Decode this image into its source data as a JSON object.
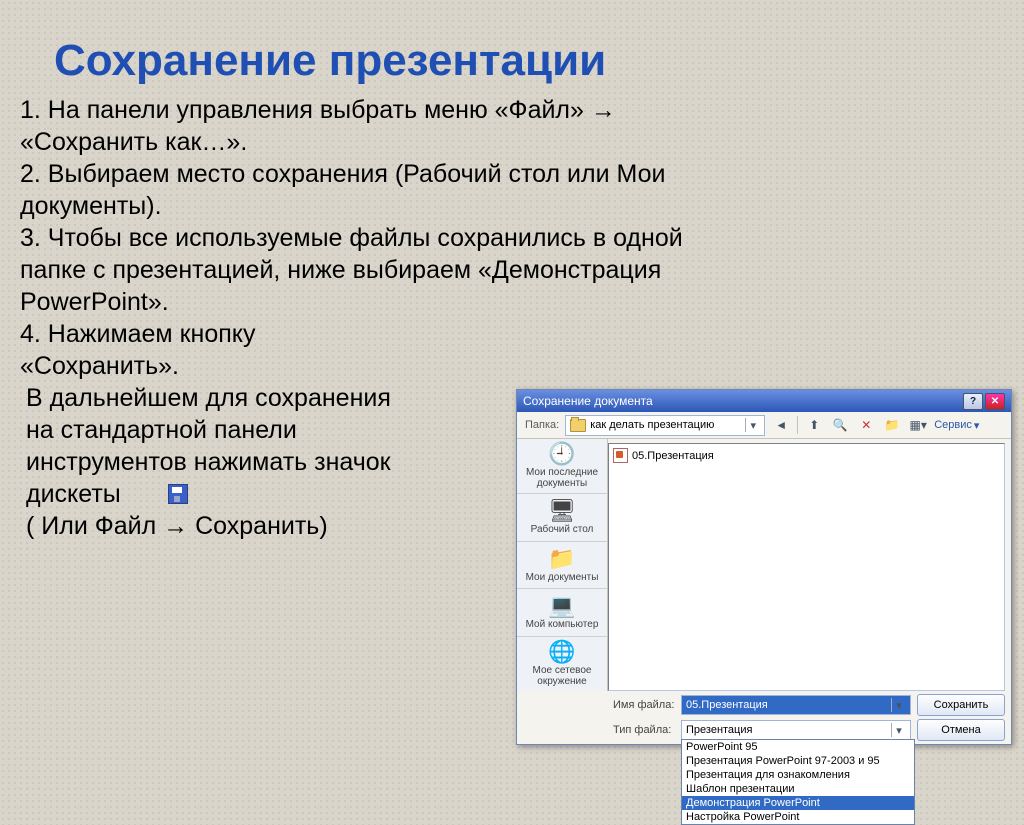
{
  "title": "Сохранение презентации",
  "steps": {
    "l1": "1. На панели управления выбрать меню «Файл» →",
    "l2": "«Сохранить как…».",
    "l3": "2. Выбираем место сохранения (Рабочий стол или Мои",
    "l4": "документы).",
    "l5": "3. Чтобы все используемые файлы сохранились в одной",
    "l6": "папке с презентацией, ниже выбираем «Демонстрация",
    "l7": "PowerPoint».",
    "l8": "4. Нажимаем кнопку",
    "l9": "«Сохранить».",
    "l10": "В дальнейшем для сохранения",
    "l11": "на стандартной панели",
    "l12": "инструментов нажимать значок",
    "l13": "дискеты",
    "l14": "( Или Файл → Сохранить)"
  },
  "dialog": {
    "title": "Сохранение документа",
    "folder_label": "Папка:",
    "folder_value": "как делать презентацию",
    "service_label": "Сервис",
    "places": [
      {
        "icon": "🕘",
        "label": "Мои последние документы"
      },
      {
        "icon": "🖥",
        "label": "Рабочий стол"
      },
      {
        "icon": "📁",
        "label": "Мои документы"
      },
      {
        "icon": "💻",
        "label": "Мой компьютер"
      },
      {
        "icon": "🌐",
        "label": "Мое сетевое окружение"
      }
    ],
    "file_item": "05.Презентация",
    "filename_label": "Имя файла:",
    "filename_value": "05.Презентация",
    "filetype_label": "Тип файла:",
    "filetype_value": "Презентация",
    "save_btn": "Сохранить",
    "cancel_btn": "Отмена",
    "type_options": [
      "PowerPoint 95",
      "Презентация PowerPoint 97-2003 и 95",
      "Презентация для ознакомления",
      "Шаблон презентации",
      "Демонстрация PowerPoint",
      "Настройка PowerPoint"
    ],
    "type_highlight_index": 4
  }
}
